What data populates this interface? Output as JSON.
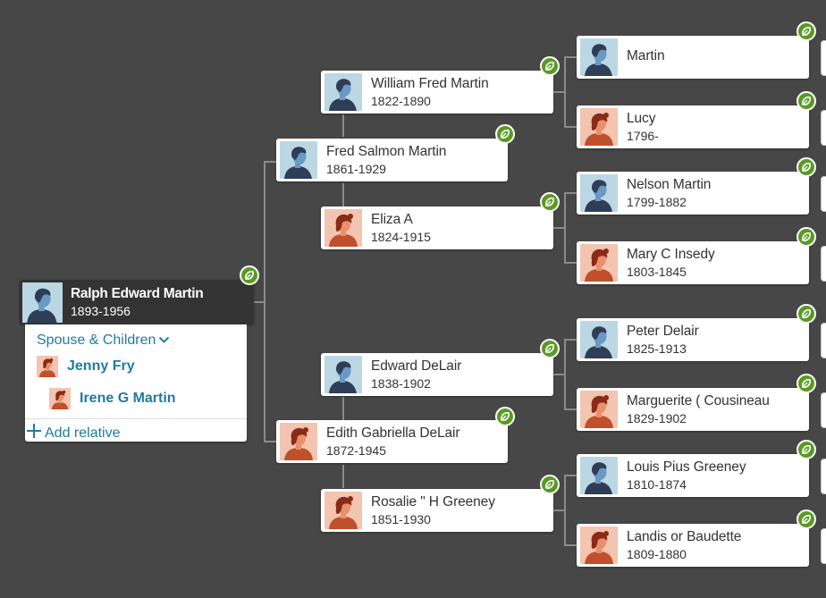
{
  "colors": {
    "canvas": "#474747",
    "card": "#ffffff",
    "root_card": "#333333",
    "link": "#1f7ba0",
    "hint": "#5a9a24",
    "male_bg": "#bcd7e4",
    "female_bg": "#f3c4b0"
  },
  "root": {
    "name": "Ralph Edward Martin",
    "dates": "1893-1956",
    "gender": "male",
    "has_hint": true
  },
  "family_panel": {
    "spouse_toggle_label": "Spouse & Children",
    "toggle_icon": "chevron-down-icon",
    "spouses": [
      {
        "name": "Jenny Fry",
        "gender": "female"
      },
      {
        "name": "Irene G Martin",
        "gender": "female"
      }
    ],
    "add_relative_label": "Add relative",
    "add_icon": "plus-icon"
  },
  "ancestors": {
    "father": {
      "name": "Fred Salmon Martin",
      "dates": "1861-1929",
      "gender": "male",
      "has_hint": true
    },
    "mother": {
      "name": "Edith Gabriella DeLair",
      "dates": "1872-1945",
      "gender": "female",
      "has_hint": true
    },
    "paternal_grandfather": {
      "name": "William Fred Martin",
      "dates": "1822-1890",
      "gender": "male",
      "has_hint": true
    },
    "paternal_grandmother": {
      "name": "Eliza A",
      "dates": "1824-1915",
      "gender": "female",
      "has_hint": true
    },
    "maternal_grandfather": {
      "name": "Edward DeLair",
      "dates": "1838-1902",
      "gender": "male",
      "has_hint": true
    },
    "maternal_grandmother": {
      "name": "Rosalie \" H Greeney",
      "dates": "1851-1930",
      "gender": "female",
      "has_hint": true
    },
    "gg1": {
      "name": "Martin",
      "dates": "",
      "gender": "male",
      "has_hint": true
    },
    "gg2": {
      "name": "Lucy",
      "dates": "1796-",
      "gender": "female",
      "has_hint": true
    },
    "gg3": {
      "name": "Nelson Martin",
      "dates": "1799-1882",
      "gender": "male",
      "has_hint": true
    },
    "gg4": {
      "name": "Mary C Insedy",
      "dates": "1803-1845",
      "gender": "female",
      "has_hint": true
    },
    "gg5": {
      "name": "Peter Delair",
      "dates": "1825-1913",
      "gender": "male",
      "has_hint": true
    },
    "gg6": {
      "name": "Marguerite ( Cousineau",
      "dates": "1829-1902",
      "gender": "female",
      "has_hint": true
    },
    "gg7": {
      "name": "Louis Pius Greeney",
      "dates": "1810-1874",
      "gender": "male",
      "has_hint": true
    },
    "gg8": {
      "name": "Landis or Baudette",
      "dates": "1809-1880",
      "gender": "female",
      "has_hint": true
    }
  }
}
